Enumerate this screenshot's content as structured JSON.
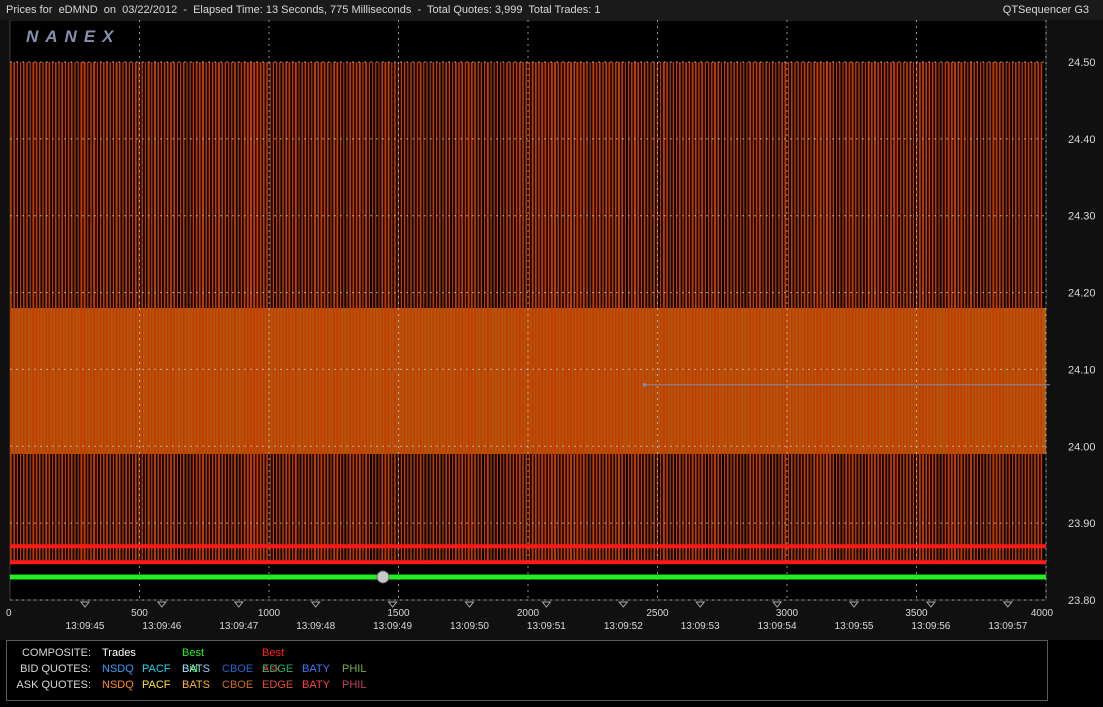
{
  "header": {
    "title": "Prices for  eDMND  on  03/22/2012  -  Elapsed Time: 13 Seconds, 775 Milliseconds  -  Total Quotes: 3,999  Total Trades: 1",
    "app_name": "QTSequencer G3",
    "logo": "NANEX"
  },
  "chart_data": {
    "type": "line",
    "title": "",
    "xlim": [
      0,
      4000
    ],
    "ylim": [
      23.8,
      24.5
    ],
    "x_ticks": [
      "0",
      "500",
      "1000",
      "1500",
      "2000",
      "2500",
      "3000",
      "3500",
      "4000"
    ],
    "y_ticks": [
      "24.50",
      "24.40",
      "24.30",
      "24.20",
      "24.10",
      "24.00",
      "23.90",
      "23.80"
    ],
    "time_ticks": [
      "13:09:45",
      "13:09:46",
      "13:09:47",
      "13:09:48",
      "13:09:49",
      "13:09:50",
      "13:09:51",
      "13:09:52",
      "13:09:53",
      "13:09:54",
      "13:09:55",
      "13:09:56",
      "13:09:57"
    ],
    "ask_oscillation_high": 24.5,
    "ask_oscillation_low": 23.85,
    "ask_band_high": 24.18,
    "ask_band_low": 23.99,
    "best_ask": 23.87,
    "best_bid": 23.83,
    "trade": {
      "x": 1440,
      "y": 23.83
    },
    "annotation_line_y": 24.08,
    "colors": {
      "background": "#000000",
      "ask_lines": "#c43a00",
      "band": "#b05a10",
      "best_ask": "#ff1a1a",
      "best_bid": "#22ee22",
      "trade": "#c8c8c8",
      "grid": "#d0d0d0"
    }
  },
  "legend": {
    "rows": [
      {
        "label": "COMPOSITE:",
        "items": [
          {
            "text": "Trades",
            "color": "#ffffff"
          },
          {
            "text": "Best Bid",
            "color": "#22ee22"
          },
          {
            "text": "Best Ask",
            "color": "#ff2020"
          }
        ]
      },
      {
        "label": "BID QUOTES:",
        "items": [
          {
            "text": "NSDQ",
            "color": "#3a9cff"
          },
          {
            "text": "PACF",
            "color": "#25d4e8"
          },
          {
            "text": "BATS",
            "color": "#9fd0ff"
          },
          {
            "text": "CBOE",
            "color": "#2a64c8"
          },
          {
            "text": "EDGE",
            "color": "#20b070"
          },
          {
            "text": "BATY",
            "color": "#3a7aff"
          },
          {
            "text": "PHIL",
            "color": "#7ab040"
          }
        ]
      },
      {
        "label": "ASK QUOTES:",
        "items": [
          {
            "text": "NSDQ",
            "color": "#ff8c20"
          },
          {
            "text": "PACF",
            "color": "#ffe040"
          },
          {
            "text": "BATS",
            "color": "#ffb040"
          },
          {
            "text": "CBOE",
            "color": "#d07020"
          },
          {
            "text": "EDGE",
            "color": "#e05030"
          },
          {
            "text": "BATY",
            "color": "#ff4040"
          },
          {
            "text": "PHIL",
            "color": "#c04060"
          }
        ]
      }
    ]
  }
}
